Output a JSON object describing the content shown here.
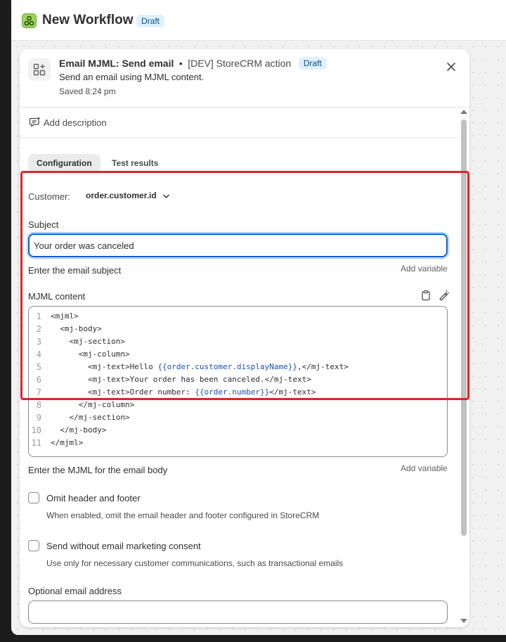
{
  "workflow": {
    "title": "New Workflow",
    "badge": "Draft"
  },
  "panel": {
    "title": "Email MJML: Send email",
    "separator": "•",
    "subtitle": "[DEV] StoreCRM action",
    "badge": "Draft",
    "description": "Send an email using MJML content.",
    "saved": "Saved 8:24 pm",
    "add_description": "Add description"
  },
  "tabs": [
    {
      "label": "Configuration",
      "active": true
    },
    {
      "label": "Test results",
      "active": false
    }
  ],
  "form": {
    "customer_label": "Customer:",
    "customer_value": "order.customer.id",
    "subject_label": "Subject",
    "subject_value": "Your order was canceled",
    "subject_help": "Enter the email subject",
    "add_variable": "Add variable",
    "mjml_label": "MJML content",
    "mjml_help": "Enter the MJML for the email body",
    "omit_label": "Omit header and footer",
    "omit_help": "When enabled, omit the email header and footer configured in StoreCRM",
    "consent_label": "Send without email marketing consent",
    "consent_help": "Use only for necessary customer communications, such as transactional emails",
    "optional_email_label": "Optional email address",
    "optional_email_value": ""
  },
  "code_lines": [
    {
      "n": "1",
      "pre": "<mjml>",
      "tpl": "",
      "post": ""
    },
    {
      "n": "2",
      "pre": "  <mj-body>",
      "tpl": "",
      "post": ""
    },
    {
      "n": "3",
      "pre": "    <mj-section>",
      "tpl": "",
      "post": ""
    },
    {
      "n": "4",
      "pre": "      <mj-column>",
      "tpl": "",
      "post": ""
    },
    {
      "n": "5",
      "pre": "        <mj-text>Hello ",
      "tpl": "{{order.customer.displayName}}",
      "post": ",</mj-text>"
    },
    {
      "n": "6",
      "pre": "        <mj-text>Your order has been canceled.</mj-text>",
      "tpl": "",
      "post": ""
    },
    {
      "n": "7",
      "pre": "        <mj-text>Order number: ",
      "tpl": "{{order.number}}",
      "post": "</mj-text>"
    },
    {
      "n": "8",
      "pre": "      </mj-column>",
      "tpl": "",
      "post": ""
    },
    {
      "n": "9",
      "pre": "    </mj-section>",
      "tpl": "",
      "post": ""
    },
    {
      "n": "10",
      "pre": "  </mj-body>",
      "tpl": "",
      "post": ""
    },
    {
      "n": "11",
      "pre": "</mjml>",
      "tpl": "",
      "post": ""
    }
  ],
  "colors": {
    "accent": "#005bd3",
    "highlight": "#d9262b",
    "badge_bg": "#e0f0ff",
    "template_var": "#1a4fb8"
  },
  "icons": {
    "workflow": "workflow-icon",
    "step": "apps-grid-icon",
    "close": "close-icon",
    "description": "comment-icon",
    "chevron": "chevron-down-icon",
    "clipboard": "clipboard-icon",
    "magic": "magic-pen-icon"
  }
}
